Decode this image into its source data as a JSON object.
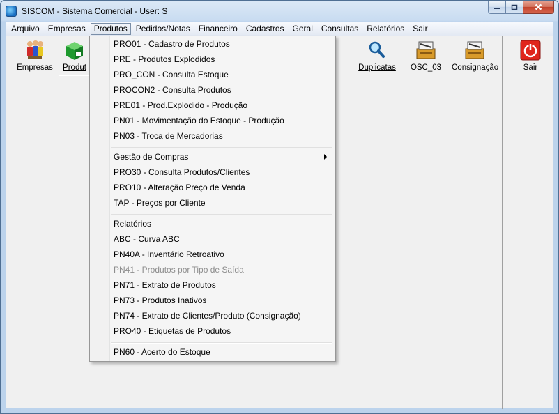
{
  "window": {
    "title": "SISCOM - Sistema Comercial - User: S"
  },
  "menubar": [
    "Arquivo",
    "Empresas",
    "Produtos",
    "Pedidos/Notas",
    "Financeiro",
    "Cadastros",
    "Geral",
    "Consultas",
    "Relatórios",
    "Sair"
  ],
  "toolbar": {
    "empresas": "Empresas",
    "produtos": "Produt",
    "duplicatas": "Duplicatas",
    "osc03": "OSC_03",
    "consignacao": "Consignação",
    "sair": "Sair"
  },
  "dropdown": {
    "items": [
      "PRO01 - Cadastro de Produtos",
      "PRE - Produtos Explodidos",
      "PRO_CON - Consulta Estoque",
      "PROCON2 - Consulta Produtos",
      "PRE01 - Prod.Explodido - Produção",
      "PN01 - Movimentação do Estoque - Produção",
      "PN03 - Troca de Mercadorias",
      "Gestão de Compras",
      "PRO30 - Consulta Produtos/Clientes",
      "PRO10 - Alteração Preço de Venda",
      "TAP - Preços por Cliente",
      "Relatórios",
      "ABC - Curva ABC",
      "PN40A - Inventário Retroativo",
      "PN41 - Produtos por Tipo de Saída",
      "PN71 - Extrato de Produtos",
      "PN73 - Produtos Inativos",
      "PN74 - Extrato de Clientes/Produto (Consignação)",
      "PRO40 - Etiquetas de Produtos",
      "PN60 - Acerto do Estoque"
    ]
  },
  "colors": {
    "close_button": "#c2422b",
    "title_accent": "#cfe0f2",
    "disabled_text": "#8d8d8d"
  }
}
